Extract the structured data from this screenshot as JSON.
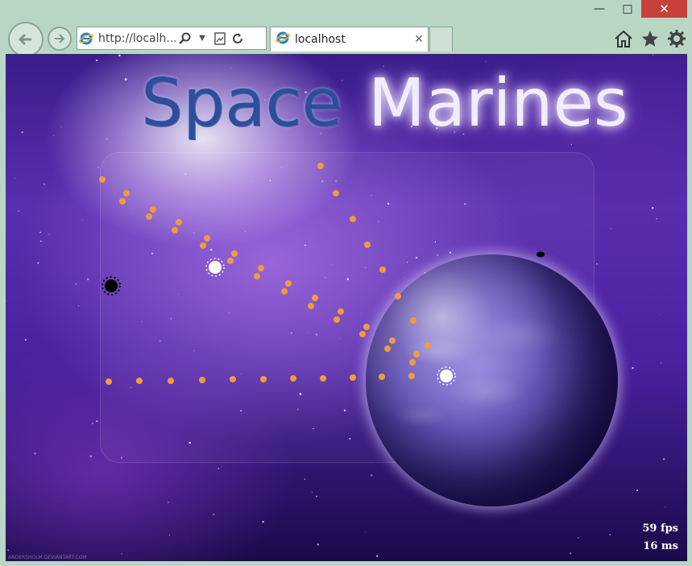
{
  "window": {
    "minimize_icon": "minimize-icon",
    "maximize_icon": "maximize-icon",
    "close_icon": "close-icon"
  },
  "browser": {
    "url": "http://localh...",
    "tab_title": "localhost",
    "icons": [
      "back-arrow-icon",
      "forward-arrow-icon",
      "ie-logo-icon",
      "search-icon",
      "dropdown-icon",
      "compatibility-icon",
      "refresh-icon",
      "close-tab-icon",
      "home-icon",
      "favorites-star-icon",
      "settings-gear-icon"
    ]
  },
  "game": {
    "title_word1": "Space",
    "title_word2": "Marines",
    "fps": "59 fps",
    "frame_time": "16 ms",
    "watermark": "ANDERSHOLM.DEVIANTART.COM",
    "colors": {
      "bullet": "#f49a3a",
      "player": "#ffffff",
      "enemy": "#000000",
      "title_blue": "#2e4e99",
      "title_glow": "#f3ecff"
    }
  }
}
